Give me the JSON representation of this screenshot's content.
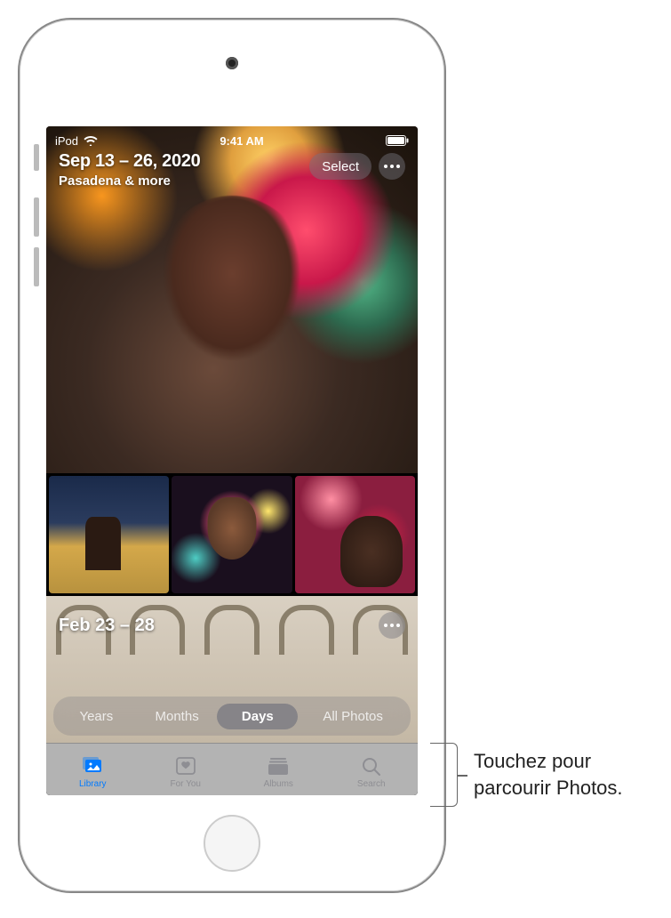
{
  "status_bar": {
    "carrier": "iPod",
    "time": "9:41 AM"
  },
  "hero": {
    "title": "Sep 13 – 26, 2020",
    "subtitle": "Pasadena & more",
    "select_label": "Select"
  },
  "section2": {
    "title": "Feb 23 – 28"
  },
  "segmented": {
    "years": "Years",
    "months": "Months",
    "days": "Days",
    "all_photos": "All Photos",
    "active": "Days"
  },
  "tabbar": {
    "library": "Library",
    "for_you": "For You",
    "albums": "Albums",
    "search": "Search",
    "active": "Library"
  },
  "callout": {
    "line1": "Touchez pour",
    "line2": "parcourir Photos."
  }
}
